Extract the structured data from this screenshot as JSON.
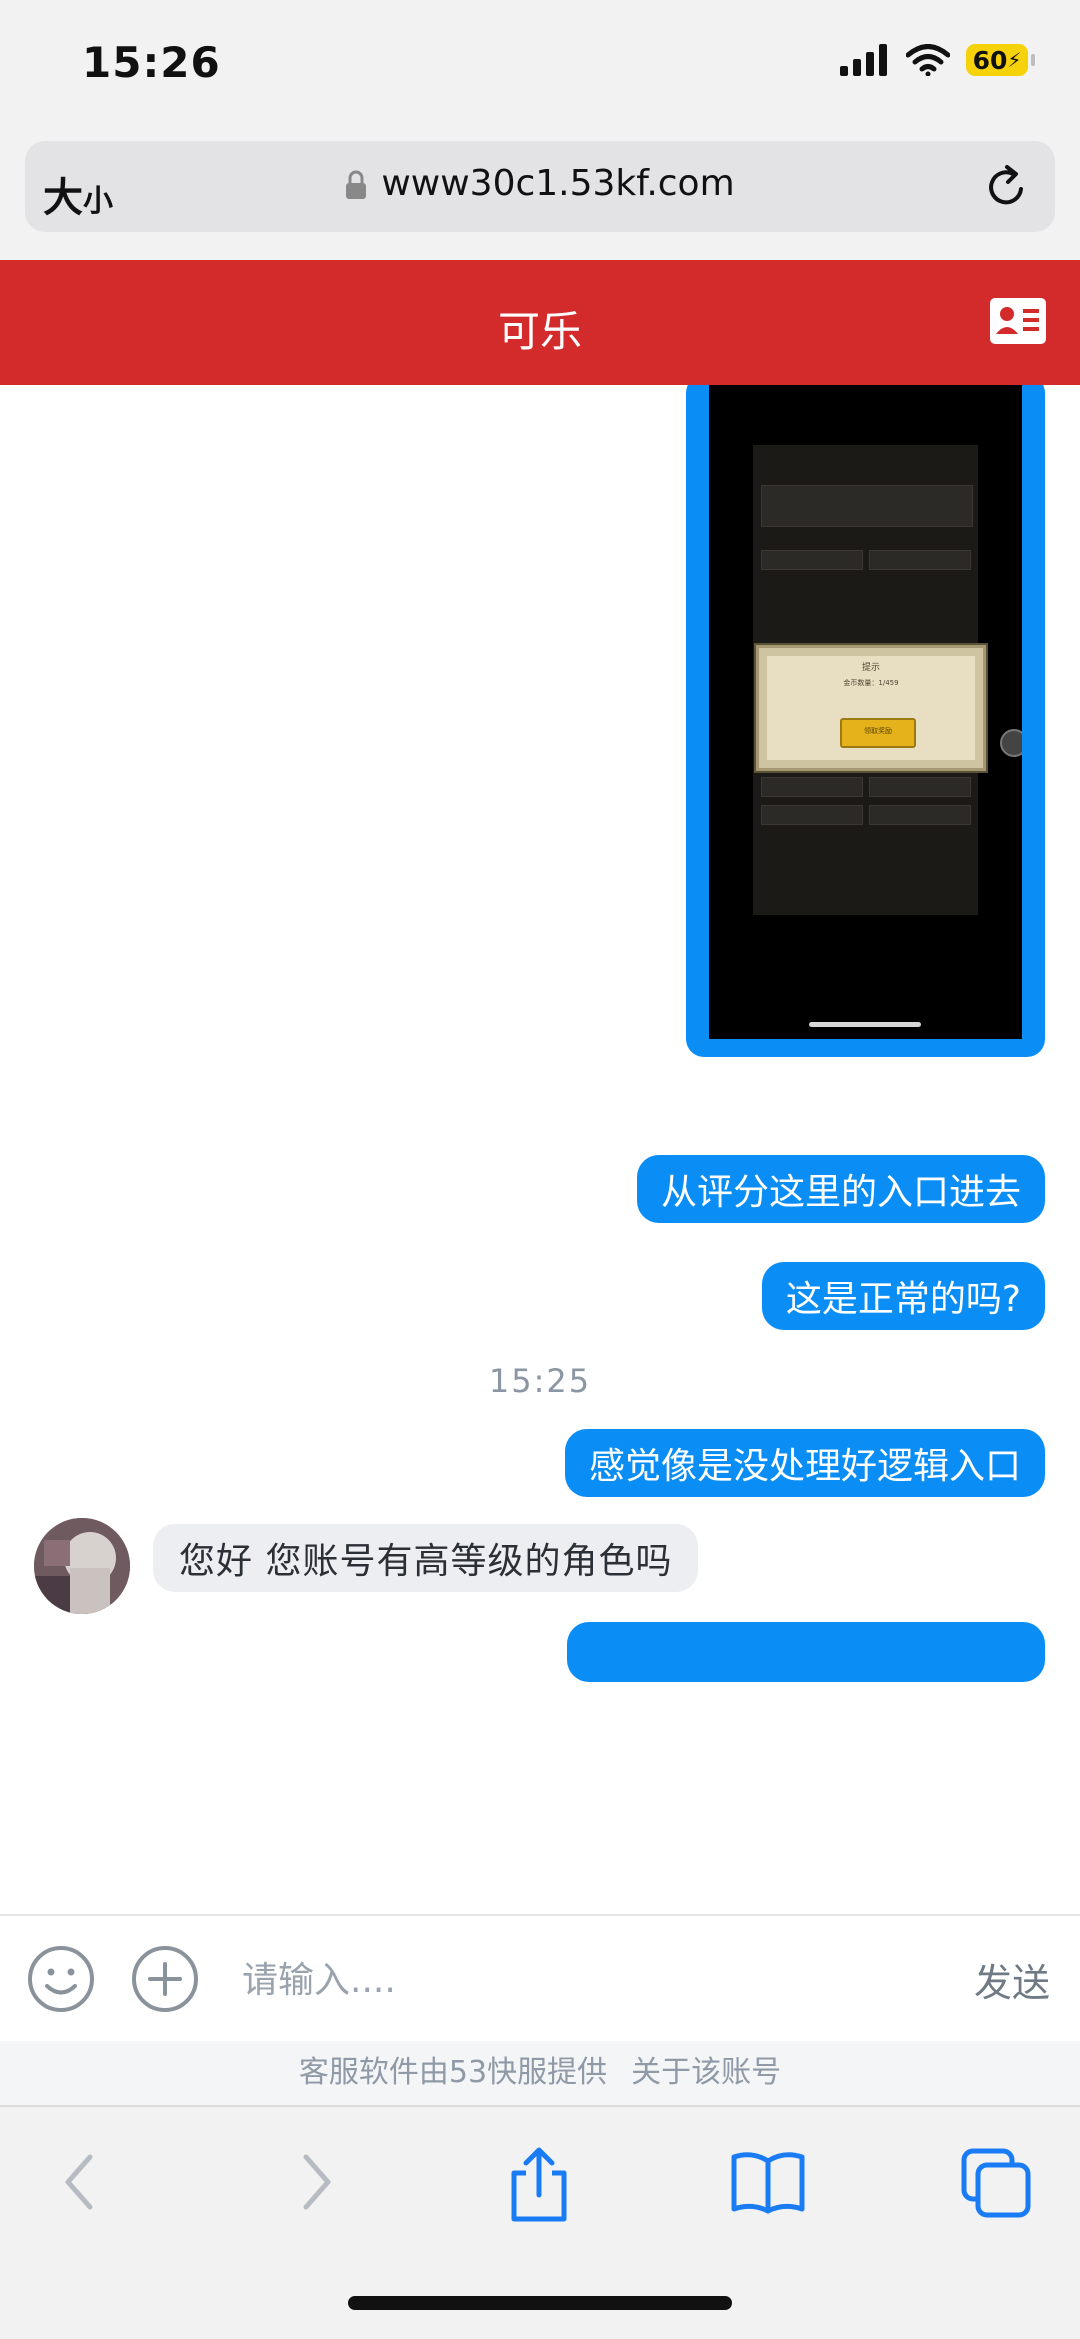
{
  "status_bar": {
    "time": "15:26",
    "battery": "60"
  },
  "browser": {
    "text_size_big": "大",
    "text_size_small": "小",
    "url": "www30c1.53kf.com"
  },
  "header": {
    "title": "可乐"
  },
  "chat": {
    "image_popup_texts": [
      "提示",
      "金币数量：1/459",
      "领取奖励"
    ],
    "messages": [
      {
        "type": "out",
        "text": "从评分这里的入口进去"
      },
      {
        "type": "out",
        "text": "这是正常的吗?"
      },
      {
        "type": "time",
        "text": "15:25"
      },
      {
        "type": "out",
        "text": "感觉像是没处理好逻辑入口"
      },
      {
        "type": "in",
        "text": "您好 您账号有高等级的角色吗"
      }
    ]
  },
  "input": {
    "placeholder": "请输入....",
    "send_label": "发送"
  },
  "footer": {
    "provider": "客服软件由53快服提供",
    "about": "关于该账号"
  },
  "colors": {
    "header": "#d32b2b",
    "bubble_out": "#0a8ef6",
    "bubble_in": "#eceef2"
  },
  "icons": [
    "lock-icon",
    "reload-icon",
    "contact-card-icon",
    "emoji-icon",
    "add-icon",
    "back-icon",
    "forward-icon",
    "share-icon",
    "bookmarks-icon",
    "tabs-icon"
  ]
}
